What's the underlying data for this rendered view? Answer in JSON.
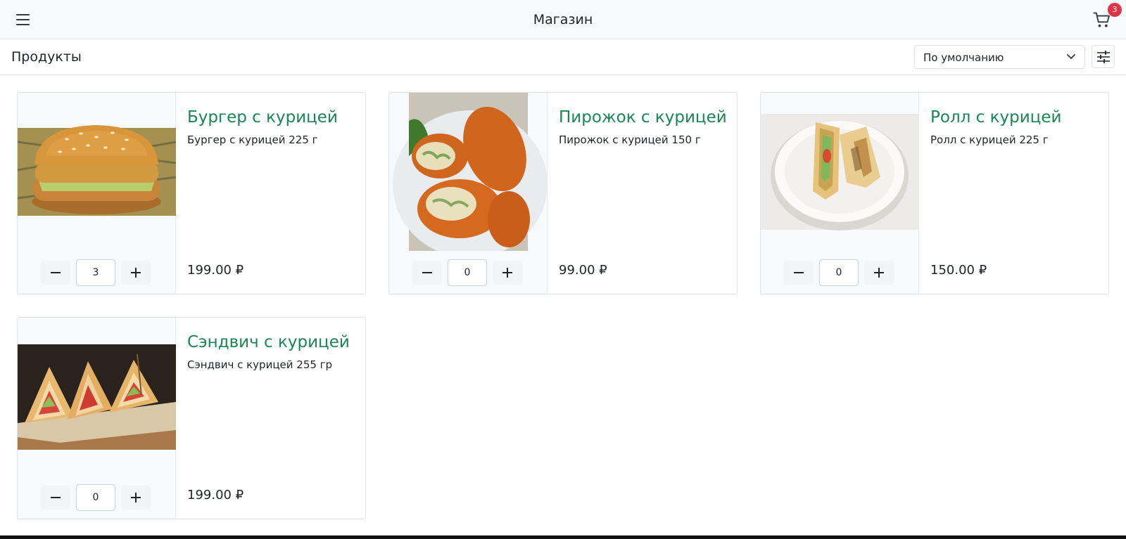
{
  "header": {
    "title": "Магазин",
    "cart_count": "3"
  },
  "toolbar": {
    "page_title": "Продукты",
    "sort_selected": "По умолчанию"
  },
  "products": [
    {
      "title": "Бургер с курицей",
      "description": "Бургер с курицей 225 г",
      "price": "199.00 ₽",
      "quantity": "3"
    },
    {
      "title": "Пирожок с курицей",
      "description": "Пирожок с курицей 150 г",
      "price": "99.00 ₽",
      "quantity": "0"
    },
    {
      "title": "Ролл с курицей",
      "description": "Ролл с курицей 225 г",
      "price": "150.00 ₽",
      "quantity": "0"
    },
    {
      "title": "Сэндвич с курицей",
      "description": "Сэндвич с курицей 255 гр",
      "price": "199.00 ₽",
      "quantity": "0"
    }
  ],
  "colors": {
    "title_green": "#198754",
    "badge_red": "#dc3545"
  }
}
